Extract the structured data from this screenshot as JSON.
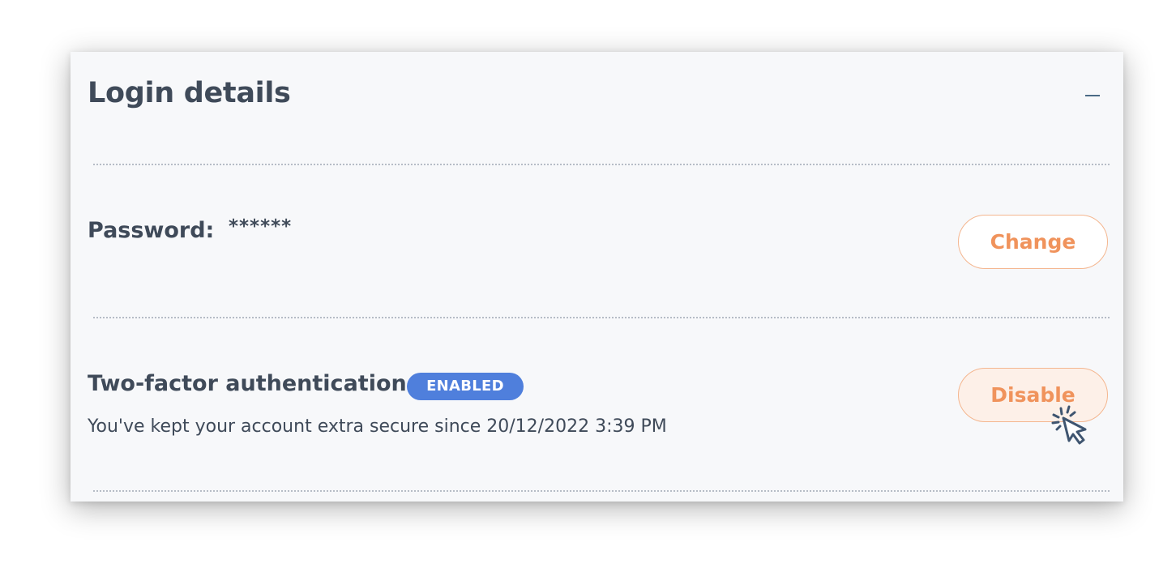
{
  "section": {
    "title": "Login details",
    "collapse_icon": "minus-icon"
  },
  "password": {
    "label": "Password:",
    "value": "******",
    "button_label": "Change"
  },
  "two_factor": {
    "label": "Two-factor authentication",
    "status_badge": "ENABLED",
    "description": "You've kept your account extra secure since 20/12/2022 3:39 PM",
    "button_label": "Disable"
  },
  "cursor_icon": "pointer-click-icon",
  "colors": {
    "text": "#3f4a59",
    "accent_orange": "#f0935c",
    "badge_blue": "#4f7fdc",
    "panel_background": "#f7f8fa"
  }
}
